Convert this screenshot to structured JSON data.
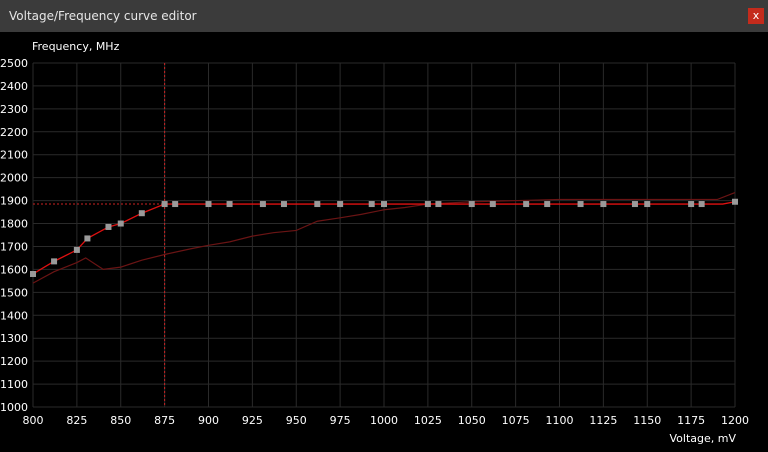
{
  "window": {
    "title": "Voltage/Frequency curve editor",
    "close_label": "x"
  },
  "colors": {
    "titlebar": "#3b3b3b",
    "close": "#c42b1c",
    "grid": "#2a2a2a",
    "curve": "#e01010",
    "reference_curve": "#6a1414",
    "point": "#9a9a9a",
    "crosshair": "#cc2222"
  },
  "chart_data": {
    "type": "line",
    "xlabel": "Voltage, mV",
    "ylabel": "Frequency, MHz",
    "xlim": [
      800,
      1200
    ],
    "ylim": [
      1000,
      2500
    ],
    "x_ticks": [
      800,
      825,
      850,
      875,
      900,
      925,
      950,
      975,
      1000,
      1025,
      1050,
      1075,
      1100,
      1125,
      1150,
      1175,
      1200
    ],
    "y_ticks": [
      1000,
      1100,
      1200,
      1300,
      1400,
      1500,
      1600,
      1700,
      1800,
      1900,
      2000,
      2100,
      2200,
      2300,
      2400,
      2500
    ],
    "grid": true,
    "crosshair": {
      "voltage": 875,
      "frequency": 1885
    },
    "series": [
      {
        "role": "curve",
        "x": [
          800,
          812,
          825,
          831,
          843,
          850,
          862,
          875,
          881,
          893,
          900,
          912,
          925,
          931,
          943,
          950,
          962,
          975,
          981,
          993,
          1000,
          1012,
          1025,
          1031,
          1043,
          1050,
          1062,
          1075,
          1081,
          1093,
          1100,
          1112,
          1125,
          1131,
          1143,
          1150,
          1162,
          1175,
          1181,
          1193,
          1200
        ],
        "values": [
          1580,
          1635,
          1685,
          1735,
          1785,
          1800,
          1845,
          1885,
          1885,
          1885,
          1885,
          1885,
          1885,
          1885,
          1885,
          1885,
          1885,
          1885,
          1885,
          1885,
          1885,
          1885,
          1885,
          1885,
          1885,
          1885,
          1885,
          1885,
          1885,
          1885,
          1885,
          1885,
          1885,
          1885,
          1885,
          1885,
          1885,
          1885,
          1885,
          1885,
          1895
        ],
        "markers": [
          true,
          true,
          true,
          true,
          true,
          true,
          true,
          true,
          true,
          false,
          true,
          true,
          false,
          true,
          true,
          false,
          true,
          true,
          false,
          true,
          true,
          false,
          true,
          true,
          false,
          true,
          true,
          false,
          true,
          true,
          false,
          true,
          true,
          false,
          true,
          true,
          false,
          true,
          true,
          false,
          true
        ]
      },
      {
        "role": "reference",
        "x": [
          800,
          812,
          825,
          830,
          840,
          850,
          862,
          875,
          890,
          900,
          912,
          925,
          937,
          950,
          962,
          975,
          987,
          1000,
          1012,
          1025,
          1050,
          1100,
          1150,
          1190,
          1200
        ],
        "values": [
          1540,
          1590,
          1630,
          1650,
          1600,
          1610,
          1640,
          1665,
          1690,
          1705,
          1720,
          1745,
          1760,
          1770,
          1810,
          1825,
          1840,
          1860,
          1870,
          1885,
          1895,
          1905,
          1905,
          1905,
          1935
        ]
      }
    ]
  }
}
